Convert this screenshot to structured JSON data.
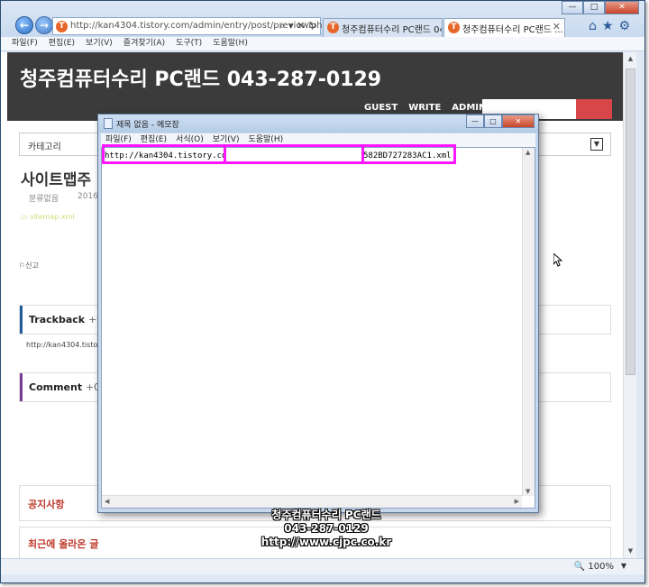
{
  "browser": {
    "address_url": "http://kan4304.tistory.com/admin/entry/post/preview.php",
    "address_icons": "⌕ ▾ ✕ ↻",
    "favicon_letter": "T",
    "tabs": [
      {
        "label": "청주컴퓨터수리 PC랜드 043..."
      },
      {
        "label": "청주컴퓨터수리 PC랜드 ..."
      }
    ],
    "toolbar_icons": "⌂★⚙",
    "window_controls": {
      "minimize": "—",
      "maximize": "□",
      "close": "✕"
    },
    "menu": [
      "파일(F)",
      "편집(E)",
      "보기(V)",
      "즐겨찾기(A)",
      "도구(T)",
      "도움말(H)"
    ],
    "zoom": "100%"
  },
  "blog": {
    "title": "청주컴퓨터수리 PC랜드 043-287-0129",
    "nav": [
      "GUEST",
      "WRITE",
      "ADMIN"
    ],
    "category_label": "카테고리",
    "post_title": "사이트맵주",
    "post_category": "분류없음",
    "post_date": "2016.",
    "attachment": "sitemap.xml",
    "report": "신고",
    "trackback_title": "Trackback",
    "trackback_count": "+0",
    "trackback_url": "http://kan4304.tistory",
    "comment_title": "Comment",
    "comment_count": "+0",
    "notice_title": "공지사항",
    "recent_title": "최근에 올라온 글"
  },
  "notepad": {
    "title": "제목 없음 - 메모장",
    "menu": [
      "파일(F)",
      "편집(E)",
      "서식(O)",
      "보기(V)",
      "도움말(H)"
    ],
    "text_head": "http://kan4304.tistory.com",
    "text_tail": "582BD727283AC1.xml"
  },
  "watermark": {
    "line1": "청주컴퓨터수리 PC랜드",
    "line2": "043-287-0129",
    "line3": "http://www.cjpc.co.kr"
  },
  "colors": {
    "highlight": "#ff17ff",
    "blog_header": "#3b3b3b",
    "search_button": "#d9464a",
    "trackback_accent": "#1f5c99",
    "comment_accent": "#7a3c97",
    "section_heading": "#c0392b"
  }
}
